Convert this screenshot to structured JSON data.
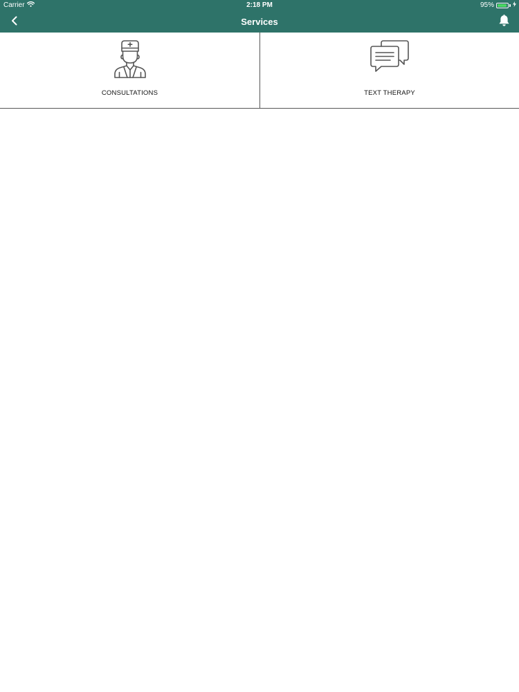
{
  "status_bar": {
    "carrier": "Carrier",
    "time": "2:18 PM",
    "battery_percent": "95%",
    "battery_level": 0.95,
    "battery_color": "#4cd964",
    "wifi_icon": "wifi-icon",
    "charging_icon": "bolt-icon"
  },
  "nav": {
    "title": "Services",
    "back_icon": "chevron-left-icon",
    "notification_icon": "bell-icon",
    "bar_color": "#2e7369"
  },
  "services": [
    {
      "label": "CONSULTATIONS",
      "icon": "doctor-icon"
    },
    {
      "label": "TEXT THERAPY",
      "icon": "chat-bubbles-icon"
    }
  ]
}
